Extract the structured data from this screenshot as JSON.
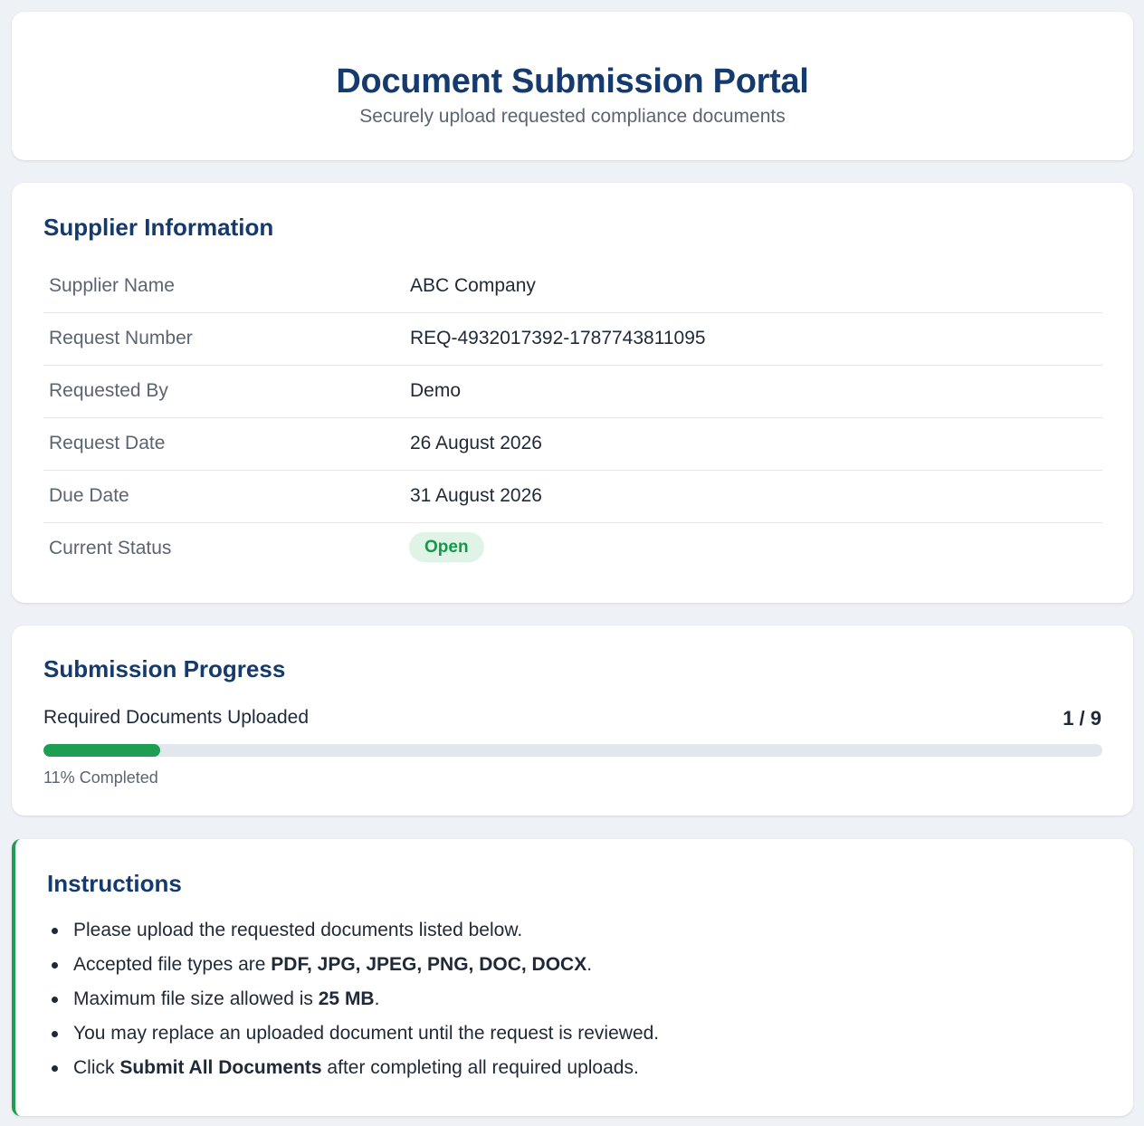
{
  "header": {
    "title": "Document Submission Portal",
    "subtitle": "Securely upload requested compliance documents"
  },
  "supplier": {
    "section_title": "Supplier Information",
    "rows": [
      {
        "label": "Supplier Name",
        "value": "ABC Company"
      },
      {
        "label": "Request Number",
        "value": "REQ-4932017392-1787743811095"
      },
      {
        "label": "Requested By",
        "value": "Demo"
      },
      {
        "label": "Request Date",
        "value": "26 August 2026"
      },
      {
        "label": "Due Date",
        "value": "31 August 2026"
      },
      {
        "label": "Current Status",
        "value": "Open"
      }
    ],
    "status_color": "#16974a"
  },
  "progress": {
    "section_title": "Submission Progress",
    "label": "Required Documents Uploaded",
    "count_text": "1 / 9",
    "uploaded": 1,
    "total": 9,
    "percent_text": "11% Completed",
    "fill_percent": 11,
    "fill_color": "#1e9e52"
  },
  "instructions": {
    "section_title": "Instructions",
    "items": [
      {
        "before": "Please upload the requested documents listed below.",
        "bold": "",
        "after": ""
      },
      {
        "before": "Accepted file types are ",
        "bold": "PDF, JPG, JPEG, PNG, DOC, DOCX",
        "after": "."
      },
      {
        "before": "Maximum file size allowed is ",
        "bold": "25 MB",
        "after": "."
      },
      {
        "before": "You may replace an uploaded document until the request is reviewed.",
        "bold": "",
        "after": ""
      },
      {
        "before": "Click ",
        "bold": "Submit All Documents",
        "after": " after completing all required uploads."
      }
    ]
  },
  "colors": {
    "brand_navy": "#143a6e",
    "accent_green": "#1e9e52",
    "page_bg": "#eef1f5"
  }
}
